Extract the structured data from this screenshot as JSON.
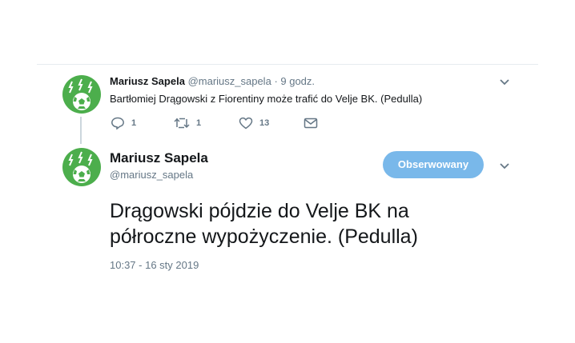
{
  "reply_tweet": {
    "name": "Mariusz Sapela",
    "handle": "@mariusz_sapela",
    "time": "· 9 godz.",
    "text": "Bartłomiej Drągowski z Fiorentiny może trafić do Velje BK. (Pedulla)",
    "reply_count": "1",
    "retweet_count": "1",
    "like_count": "13"
  },
  "main_tweet": {
    "name": "Mariusz Sapela",
    "handle": "@mariusz_sapela",
    "follow_label": "Obserwowany",
    "text": "Drągowski pójdzie do Velje BK na półroczne wypożyczenie. (Pedulla)",
    "timestamp": "10:37 - 16 sty 2019"
  },
  "colors": {
    "avatar_bg": "#4cae4c",
    "follow_button": "#79b8ea",
    "secondary_text": "#657786"
  }
}
